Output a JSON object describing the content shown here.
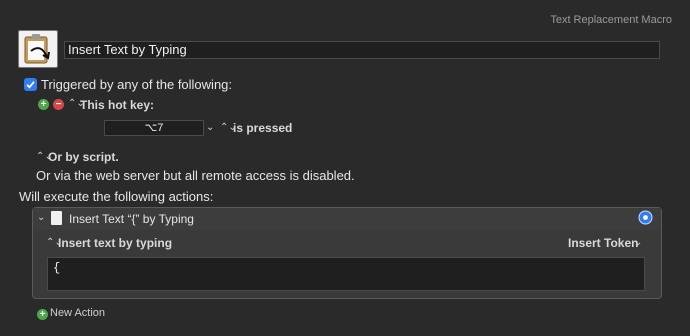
{
  "header": {
    "macro_group": "Text Replacement Macro"
  },
  "macro": {
    "name": "Insert Text by Typing"
  },
  "trigger": {
    "checked": true,
    "label": "Triggered by any of the following:",
    "hotkey_label": "This hot key:",
    "hotkey_value": "⌥7",
    "is_pressed": "is pressed",
    "or_by_script": "Or by script.",
    "web_server_note": "Or via the web server but all remote access is disabled."
  },
  "actions": {
    "header": "Will execute the following actions:",
    "items": [
      {
        "title": "Insert Text “{” by Typing",
        "mode_label": "Insert text by typing",
        "insert_token": "Insert Token",
        "text": "{"
      }
    ],
    "new_action": "New Action"
  },
  "colors": {
    "background": "#2b2a2a",
    "accent": "#2f7cf6",
    "add_green": "#4aa84a",
    "remove_red": "#d94646"
  }
}
